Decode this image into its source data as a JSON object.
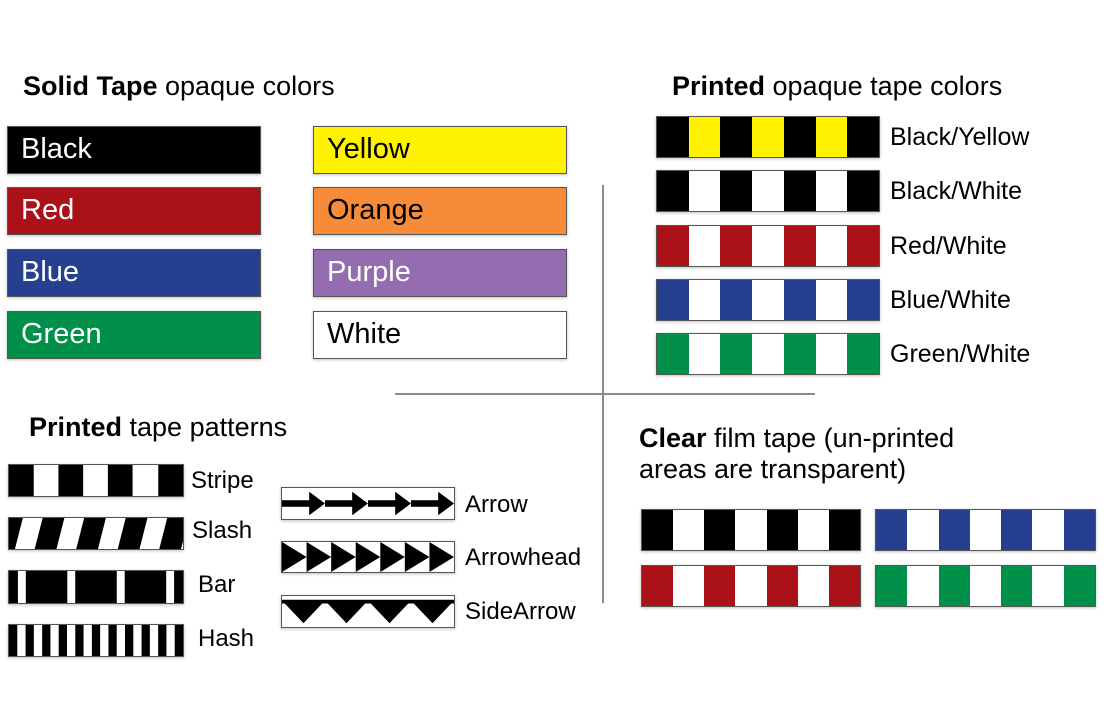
{
  "colors": {
    "black": "#000000",
    "white": "#ffffff",
    "red": "#ab1118",
    "blue": "#26408f",
    "green": "#00904a",
    "yellow": "#fff200",
    "orange": "#f68b3a",
    "purple": "#936db0"
  },
  "solid_section": {
    "heading_bold": "Solid Tape",
    "heading_rest": " opaque colors",
    "tapes": [
      {
        "label": "Black",
        "color": "#000000",
        "text_color": "#ffffff"
      },
      {
        "label": "Red",
        "color": "#ab1118",
        "text_color": "#ffffff"
      },
      {
        "label": "Blue",
        "color": "#26408f",
        "text_color": "#ffffff"
      },
      {
        "label": "Green",
        "color": "#00904a",
        "text_color": "#ffffff"
      },
      {
        "label": "Yellow",
        "color": "#fff200",
        "text_color": "#000000"
      },
      {
        "label": "Orange",
        "color": "#f68b3a",
        "text_color": "#000000"
      },
      {
        "label": "Purple",
        "color": "#936db0",
        "text_color": "#ffffff"
      },
      {
        "label": "White",
        "color": "#ffffff",
        "text_color": "#000000"
      }
    ]
  },
  "printed_colors_section": {
    "heading_bold": "Printed",
    "heading_rest": " opaque tape colors",
    "tapes": [
      {
        "label": "Black/Yellow",
        "primary": "#000000",
        "secondary": "#fff200"
      },
      {
        "label": "Black/White",
        "primary": "#000000",
        "secondary": "#ffffff"
      },
      {
        "label": "Red/White",
        "primary": "#ab1118",
        "secondary": "#ffffff"
      },
      {
        "label": "Blue/White",
        "primary": "#26408f",
        "secondary": "#ffffff"
      },
      {
        "label": "Green/White",
        "primary": "#00904a",
        "secondary": "#ffffff"
      }
    ],
    "stripe_count": 7
  },
  "patterns_section": {
    "heading_bold": "Printed",
    "heading_rest": " tape patterns",
    "patterns": [
      {
        "label": "Stripe",
        "type": "stripe"
      },
      {
        "label": "Slash",
        "type": "slash"
      },
      {
        "label": "Bar",
        "type": "bar"
      },
      {
        "label": "Hash",
        "type": "hash"
      },
      {
        "label": "Arrow",
        "type": "arrow",
        "count": 4
      },
      {
        "label": "Arrowhead",
        "type": "arrowhead",
        "count": 7
      },
      {
        "label": "SideArrow",
        "type": "sidearrow",
        "count": 4
      }
    ]
  },
  "clear_section": {
    "heading_bold": "Clear",
    "heading_line1_rest": " film tape (un-printed",
    "heading_line2": "areas are transparent)",
    "tapes": [
      {
        "name": "black-clear",
        "primary": "#000000"
      },
      {
        "name": "blue-clear",
        "primary": "#26408f"
      },
      {
        "name": "red-clear",
        "primary": "#ab1118"
      },
      {
        "name": "green-clear",
        "primary": "#00904a"
      }
    ],
    "stripe_count": 7
  }
}
